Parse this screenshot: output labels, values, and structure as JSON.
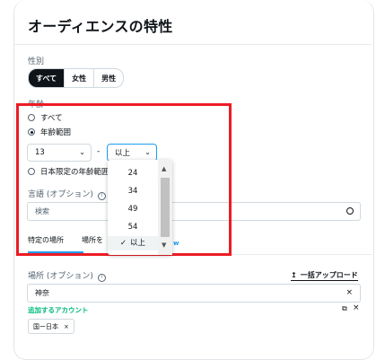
{
  "panel": {
    "title": "オーディエンスの特性"
  },
  "gender": {
    "label": "性別",
    "options": [
      "すべて",
      "女性",
      "男性"
    ],
    "selected": "すべて"
  },
  "age": {
    "label": "年齢",
    "options": [
      {
        "label": "すべて",
        "checked": false
      },
      {
        "label": "年齢範囲",
        "checked": true
      },
      {
        "label": "日本限定の年齢範囲",
        "checked": false
      }
    ],
    "from_value": "13",
    "separator": "-",
    "to_value": "以上",
    "dropdown_items": [
      "24",
      "34",
      "49",
      "54",
      "以上"
    ],
    "dropdown_selected": "以上"
  },
  "language": {
    "label": "言語 (オプション)",
    "info_icon": "info-icon",
    "placeholder": "検索"
  },
  "location": {
    "tabs": [
      "特定の場所",
      "場所を"
    ],
    "tab_badge": "w",
    "label": "場所 (オプション)",
    "info_icon": "info-icon",
    "bulk_upload": "一括アップロード",
    "value": "神奈",
    "excluded_label": "追加するアカウント",
    "chip": "国ー日本"
  },
  "colors": {
    "accent": "#1d9bf0",
    "highlight": "#ec1c24",
    "green": "#00ba7c",
    "text": "#0f1419"
  }
}
